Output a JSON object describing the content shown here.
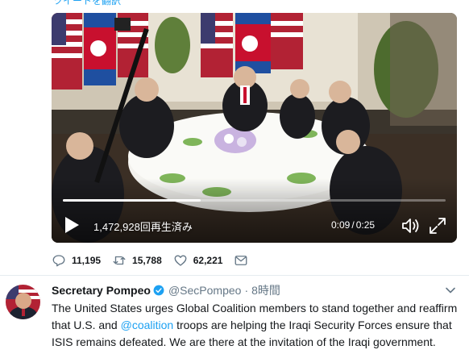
{
  "translate_link": "ツイートを翻訳",
  "video": {
    "views": "1,472,928回再生済み",
    "current_time": "0:09",
    "separator": "/",
    "duration": "0:25",
    "progress_fraction": 0.36
  },
  "actions": {
    "replies": "11,195",
    "retweets": "15,788",
    "likes": "62,221"
  },
  "tweet": {
    "name": "Secretary Pompeo",
    "handle": "@SecPompeo",
    "dot": "·",
    "time_ago": "8時間",
    "text_part1": "The United States urges Global Coalition members to stand together and reaffirm that U.S. and ",
    "mention": "@coalition",
    "text_part2": " troops are helping the Iraqi Security Forces ensure that ISIS remains defeated. We are there at the invitation of the Iraqi government."
  },
  "colors": {
    "accent": "#1da1f2",
    "muted": "#657786",
    "text": "#14171a"
  },
  "icons": [
    "play-icon",
    "volume-icon",
    "fullscreen-icon",
    "reply-icon",
    "retweet-icon",
    "like-icon",
    "dm-icon",
    "verified-icon",
    "chevron-down-icon"
  ]
}
